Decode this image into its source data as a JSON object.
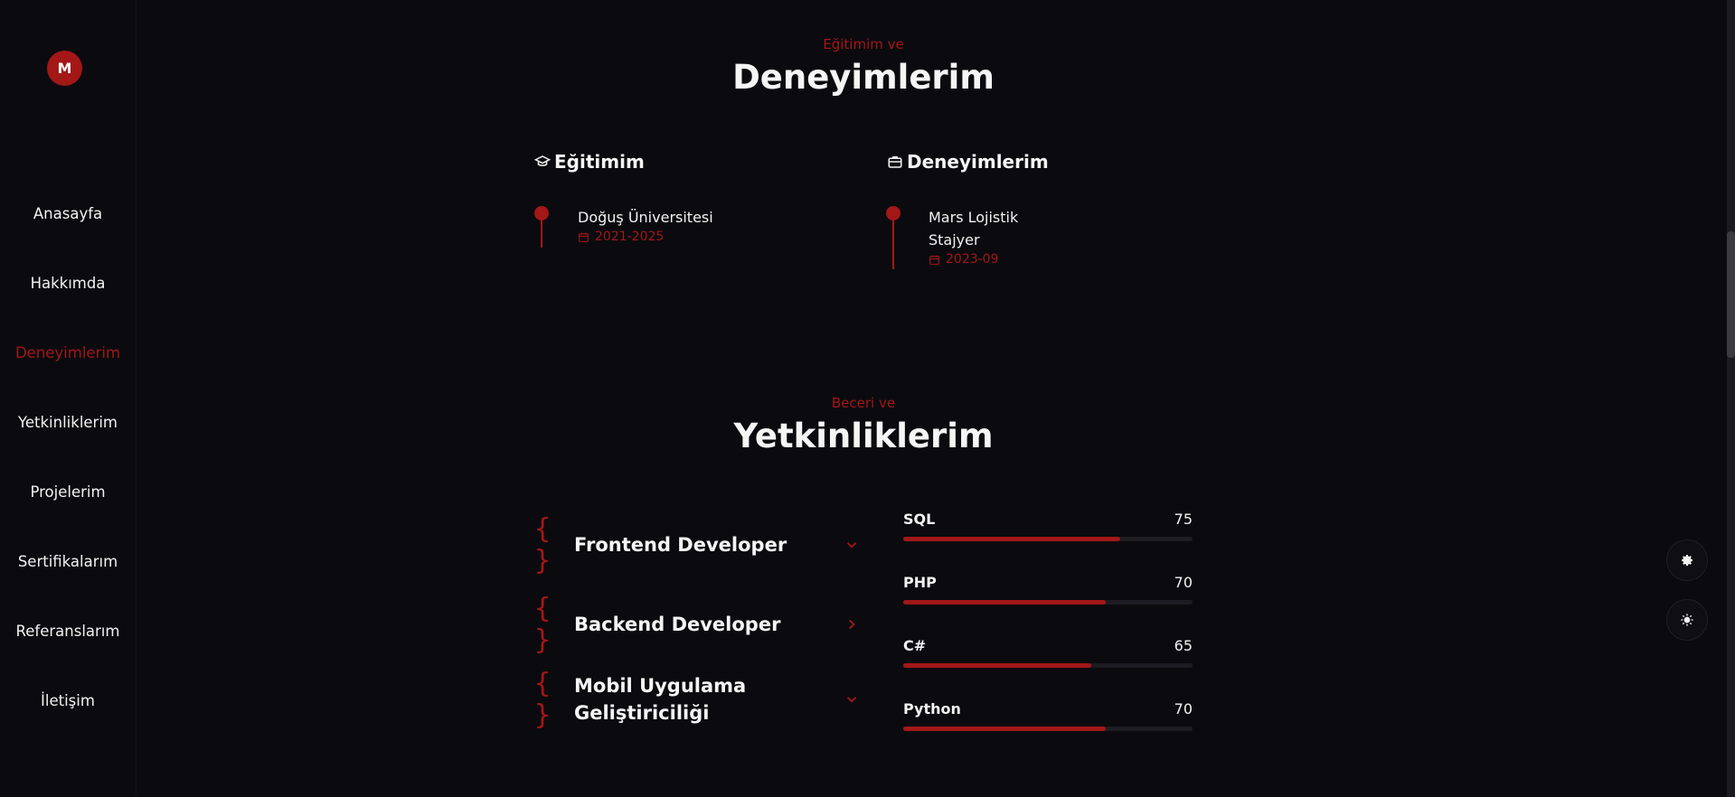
{
  "logo": {
    "letter": "M"
  },
  "nav": {
    "items": [
      {
        "label": "Anasayfa"
      },
      {
        "label": "Hakkımda"
      },
      {
        "label": "Deneyimlerim"
      },
      {
        "label": "Yetkinliklerim"
      },
      {
        "label": "Projelerim"
      },
      {
        "label": "Sertifikalarım"
      },
      {
        "label": "Referanslarım"
      },
      {
        "label": "İletişim"
      }
    ],
    "active": "Deneyimlerim"
  },
  "experience": {
    "subtitle": "Eğitimim ve",
    "title": "Deneyimlerim",
    "education": {
      "heading": "Eğitimim",
      "icon": "graduation-cap-icon",
      "items": [
        {
          "name": "Doğuş Üniversitesi",
          "date": "2021-2025"
        }
      ]
    },
    "work": {
      "heading": "Deneyimlerim",
      "icon": "briefcase-icon",
      "items": [
        {
          "name": "Mars Lojistik",
          "role": "Stajyer",
          "date": "2023-09"
        }
      ]
    }
  },
  "skills": {
    "subtitle": "Beceri ve",
    "title": "Yetkinliklerim",
    "categories": [
      {
        "label": "Frontend Developer",
        "icon": "chevron-down-icon"
      },
      {
        "label": "Backend Developer",
        "icon": "chevron-right-icon"
      },
      {
        "label": "Mobil Uygulama Geliştiriciliği",
        "icon": "chevron-down-icon"
      }
    ],
    "bars": [
      {
        "name": "SQL",
        "value": "75",
        "percent": 75
      },
      {
        "name": "PHP",
        "value": "70",
        "percent": 70
      },
      {
        "name": "C#",
        "value": "65",
        "percent": 65
      },
      {
        "name": "Python",
        "value": "70",
        "percent": 70
      }
    ]
  },
  "floating": {
    "buttons": [
      {
        "icon": "gear-icon"
      },
      {
        "icon": "sun-icon"
      }
    ]
  },
  "colors": {
    "accent": "#a31717",
    "background": "#0b0b0f",
    "text": "#f2f2f2"
  }
}
